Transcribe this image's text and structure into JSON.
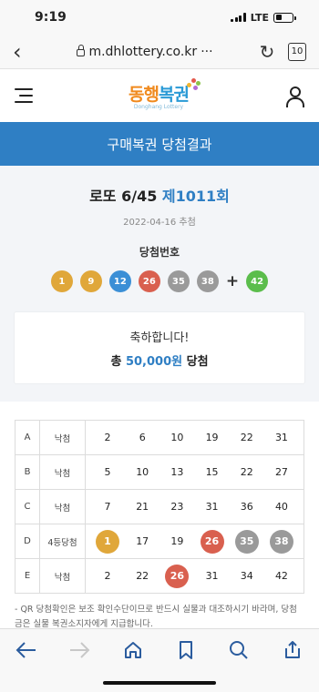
{
  "status": {
    "time": "9:19",
    "network": "LTE"
  },
  "browser": {
    "url": "m.dhlottery.co.kr",
    "url_more": "···",
    "tab_count": "10"
  },
  "site": {
    "logo_text_a": "동행",
    "logo_text_b": "복권",
    "logo_sub": "Donghang Lottery"
  },
  "page": {
    "title": "구매복권 당첨결과"
  },
  "result": {
    "game": "로또 6/45",
    "round": "제1011회",
    "date": "2022-04-16 추첨",
    "numbers_label": "당첨번호",
    "winning_numbers": [
      {
        "value": "1",
        "color": "#e0a73a"
      },
      {
        "value": "9",
        "color": "#e0a73a"
      },
      {
        "value": "12",
        "color": "#3b8fd6"
      },
      {
        "value": "26",
        "color": "#d9604f"
      },
      {
        "value": "35",
        "color": "#9a9a9a"
      },
      {
        "value": "38",
        "color": "#9a9a9a"
      }
    ],
    "plus": "+",
    "bonus": {
      "value": "42",
      "color": "#5bbd4c"
    },
    "congrats": "축하합니다!",
    "prize_prefix": "총",
    "prize_amount": "50,000원",
    "prize_suffix": "당첨"
  },
  "tickets": [
    {
      "slot": "A",
      "result": "낙첨",
      "numbers": [
        "2",
        "6",
        "10",
        "19",
        "22",
        "31"
      ],
      "hits": []
    },
    {
      "slot": "B",
      "result": "낙첨",
      "numbers": [
        "5",
        "10",
        "13",
        "15",
        "22",
        "27"
      ],
      "hits": []
    },
    {
      "slot": "C",
      "result": "낙첨",
      "numbers": [
        "7",
        "21",
        "23",
        "31",
        "36",
        "40"
      ],
      "hits": []
    },
    {
      "slot": "D",
      "result": "4등당첨",
      "numbers": [
        "1",
        "17",
        "19",
        "26",
        "35",
        "38"
      ],
      "hits": [
        "#e0a73a",
        null,
        null,
        "#d9604f",
        "#9a9a9a",
        "#9a9a9a"
      ]
    },
    {
      "slot": "E",
      "result": "낙첨",
      "numbers": [
        "2",
        "22",
        "26",
        "31",
        "34",
        "42"
      ],
      "hits": [
        null,
        null,
        "#d9604f",
        null,
        null,
        null
      ]
    }
  ],
  "notice": "- QR 당첨확인은 보조 확인수단이므로 반드시 실물과 대조하시기 바라며, 당첨금은 실물 복권소지자에게 지급합니다.",
  "toolbar_icons": [
    "back-arrow-icon",
    "forward-arrow-icon",
    "home-icon",
    "bookmark-icon",
    "search-icon",
    "share-icon"
  ]
}
